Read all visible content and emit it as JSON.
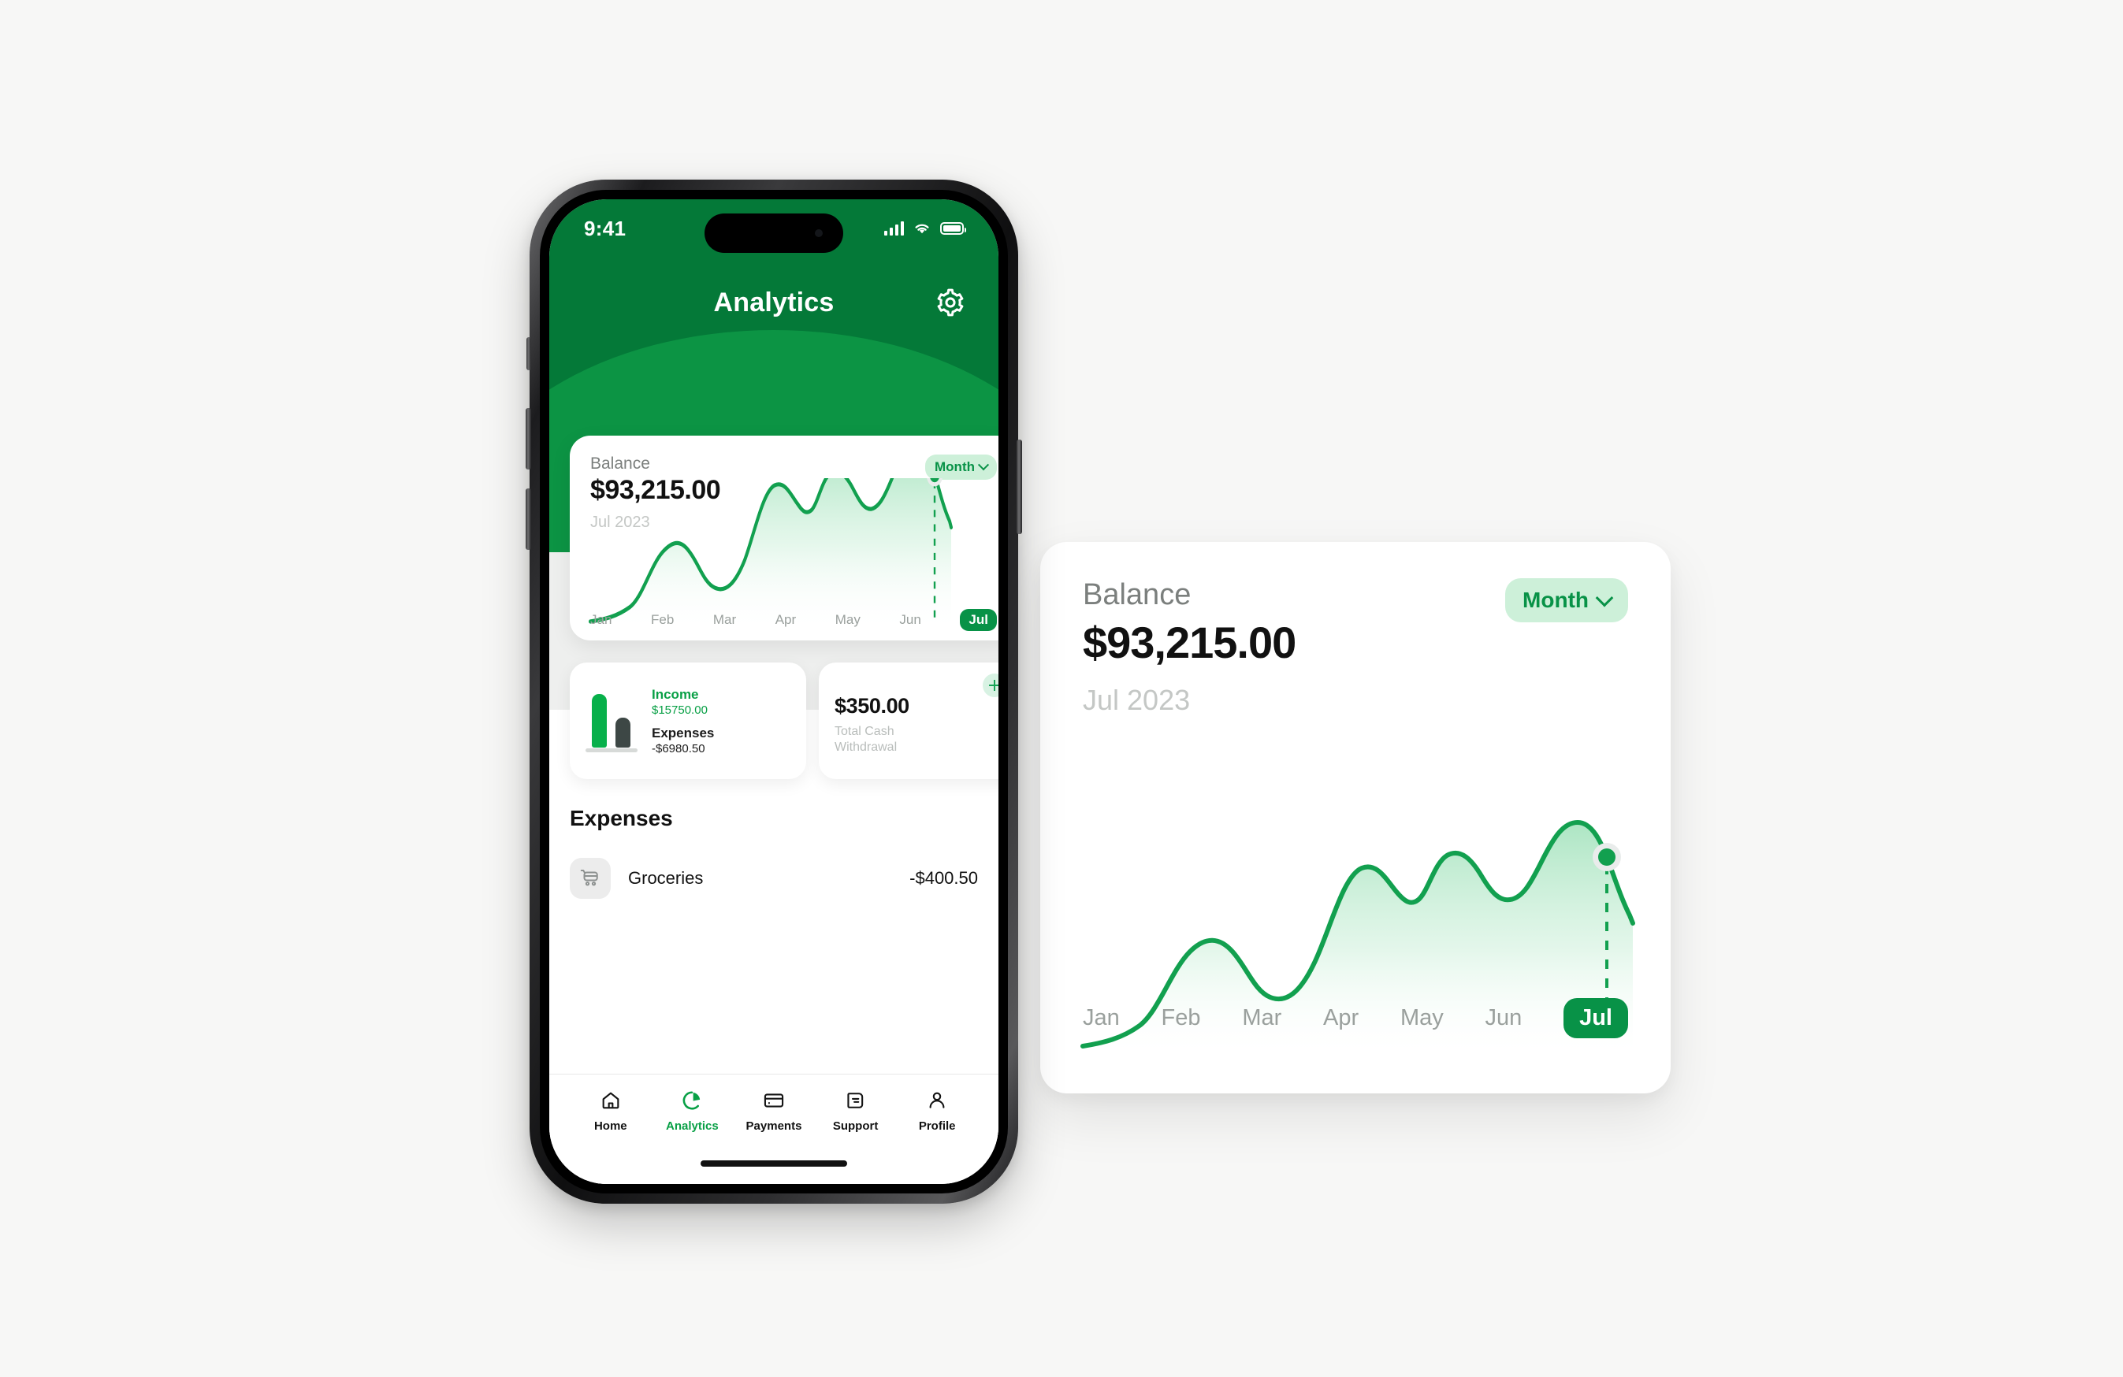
{
  "status_bar": {
    "time": "9:41",
    "signal_icon": "signal-bars-icon",
    "wifi_icon": "wifi-icon",
    "battery_icon": "battery-icon"
  },
  "header": {
    "title": "Analytics",
    "settings_icon": "gear-icon"
  },
  "balance_card": {
    "label": "Balance",
    "amount": "$93,215.00",
    "period": "Jul 2023",
    "range_chip": "Month",
    "chevron_icon": "chevron-down-icon"
  },
  "income_card": {
    "income_label": "Income",
    "income_value": "$15750.00",
    "expenses_label": "Expenses",
    "expenses_value": "-$6980.50",
    "bar_icon": "bar-chart-icon"
  },
  "cash_card": {
    "amount": "$350.00",
    "caption_line1": "Total Cash",
    "caption_line2": "Withdrawal",
    "add_icon": "plus-icon"
  },
  "expenses_section": {
    "title": "Expenses",
    "rows": [
      {
        "icon": "shopping-cart-icon",
        "name": "Groceries",
        "amount": "-$400.50"
      }
    ]
  },
  "tab_bar": {
    "items": [
      {
        "label": "Home",
        "icon": "home-icon",
        "active": false
      },
      {
        "label": "Analytics",
        "icon": "pie-chart-icon",
        "active": true
      },
      {
        "label": "Payments",
        "icon": "credit-card-icon",
        "active": false
      },
      {
        "label": "Support",
        "icon": "message-icon",
        "active": false
      },
      {
        "label": "Profile",
        "icon": "person-icon",
        "active": false
      }
    ]
  },
  "colors": {
    "brand_green": "#089247",
    "header_green": "#047938",
    "header_arc_green": "#0c9444",
    "chip_bg": "#cdf0d9",
    "page_bg": "#f7f7f6"
  },
  "chart_data": {
    "type": "area",
    "title": "Balance",
    "subtitle": "Jul 2023",
    "categories": [
      "Jan",
      "Feb",
      "Mar",
      "Apr",
      "May",
      "Jun",
      "Jul"
    ],
    "tick_labels": [
      "Jan",
      "Feb",
      "Mar",
      "Apr",
      "May",
      "Jun",
      "Jul"
    ],
    "selected_category": "Jul",
    "highlighted_value": "$93,215.00",
    "series": [
      {
        "name": "Balance",
        "x": [
          0,
          0.25,
          0.5,
          0.75,
          1,
          1.25,
          1.5,
          1.75,
          2,
          2.25,
          2.5,
          2.75,
          3,
          3.25,
          3.5,
          3.75,
          4,
          4.25,
          4.5,
          4.75,
          5,
          5.25,
          5.5,
          5.75,
          6,
          6.3
        ],
        "values": [
          6,
          8,
          12,
          22,
          40,
          46,
          44,
          38,
          33,
          32,
          34,
          52,
          66,
          62,
          58,
          68,
          72,
          70,
          64,
          61,
          63,
          78,
          84,
          80,
          72,
          52
        ]
      }
    ],
    "ylim": [
      0,
      100
    ],
    "xlabel": "",
    "ylabel": "",
    "grid": false,
    "legend": "none",
    "line_color": "#12a04f",
    "fill_gradient_from": "#a8e4c0",
    "fill_gradient_to": "#ffffff",
    "marker": {
      "category": "Jul",
      "style": "dot-with-dashed-drop-line"
    }
  }
}
